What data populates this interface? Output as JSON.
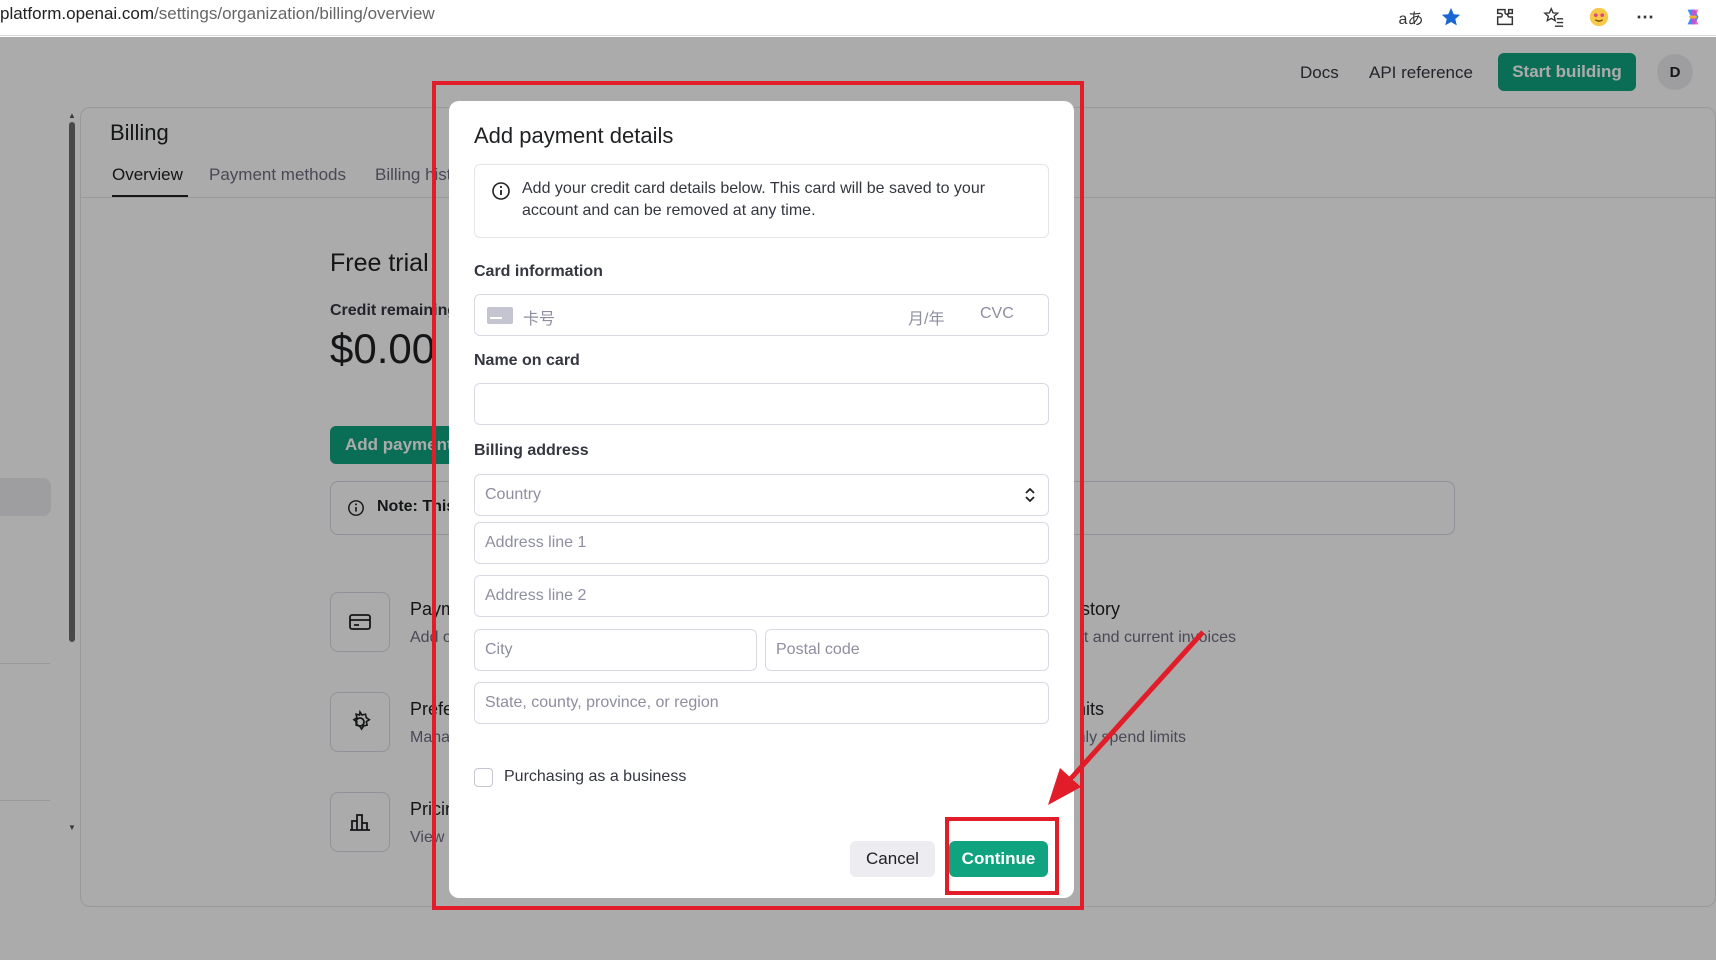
{
  "browser": {
    "url_host": "platform.openai.com",
    "url_path": "/settings/organization/billing/overview",
    "read_aloud_label": "aあ"
  },
  "topnav": {
    "docs": "Docs",
    "api_reference": "API reference",
    "start_building": "Start building",
    "avatar_initial": "D"
  },
  "billing": {
    "title": "Billing",
    "tabs": [
      {
        "label": "Overview",
        "active": true
      },
      {
        "label": "Payment methods",
        "active": false
      },
      {
        "label": "Billing history",
        "active": false
      }
    ],
    "free_trial": "Free trial",
    "credit_label": "Credit remaining",
    "credit_value": "$0.00",
    "add_payment_label": "Add payment details",
    "note_text": "Note: This",
    "features": [
      {
        "title": "Payment methods",
        "subtitle": "Add or change payment method"
      },
      {
        "title": "Preferences",
        "subtitle": "Manage billing information"
      },
      {
        "title": "Pricing",
        "subtitle": "View pricing and FAQs"
      }
    ],
    "right_features": [
      {
        "title": "Billing history",
        "subtitle": "View past and current invoices"
      },
      {
        "title": "Usage limits",
        "subtitle": "Set monthly spend limits"
      }
    ]
  },
  "modal": {
    "title": "Add payment details",
    "info_text": "Add your credit card details below. This card will be saved to your account and can be removed at any time.",
    "card_info_label": "Card information",
    "card_number_placeholder": "卡号",
    "expiry_placeholder": "月/年",
    "cvc_placeholder": "CVC",
    "name_label": "Name on card",
    "name_value": "",
    "billing_address_label": "Billing address",
    "country_placeholder": "Country",
    "address1_placeholder": "Address line 1",
    "address2_placeholder": "Address line 2",
    "city_placeholder": "City",
    "postal_placeholder": "Postal code",
    "state_placeholder": "State, county, province, or region",
    "business_checkbox_label": "Purchasing as a business",
    "business_checked": false,
    "cancel_label": "Cancel",
    "continue_label": "Continue"
  },
  "colors": {
    "brand_green": "#10a37f",
    "annotation_red": "#e21d2a",
    "overlay": "rgba(0,0,0,0.33)"
  }
}
